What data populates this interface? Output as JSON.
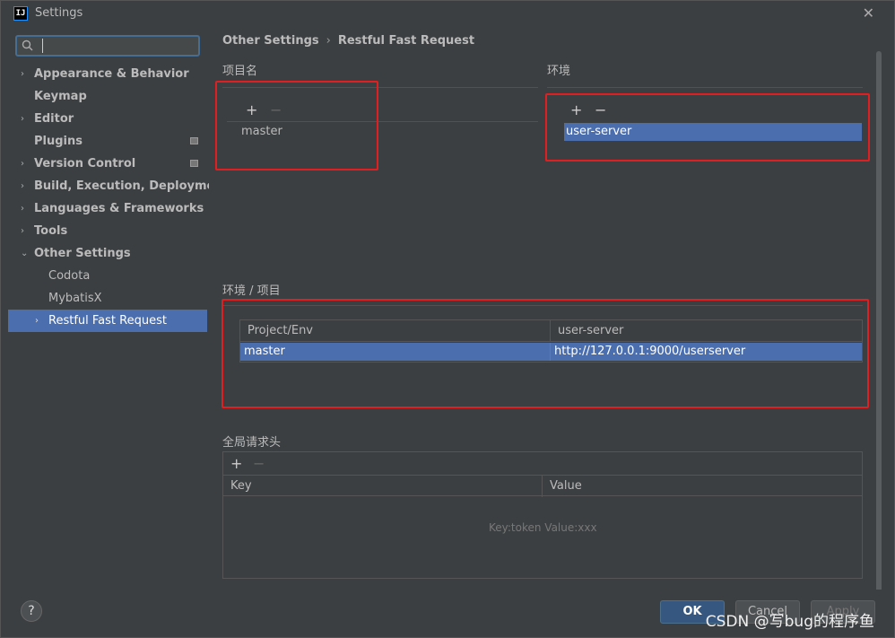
{
  "window": {
    "title": "Settings"
  },
  "search": {
    "placeholder": "",
    "value": ""
  },
  "sidebar": {
    "items": [
      {
        "label": "Appearance & Behavior",
        "arrow": "›"
      },
      {
        "label": "Keymap",
        "arrow": ""
      },
      {
        "label": "Editor",
        "arrow": "›"
      },
      {
        "label": "Plugins",
        "arrow": ""
      },
      {
        "label": "Version Control",
        "arrow": "›"
      },
      {
        "label": "Build, Execution, Deployment",
        "arrow": "›"
      },
      {
        "label": "Languages & Frameworks",
        "arrow": "›"
      },
      {
        "label": "Tools",
        "arrow": "›"
      },
      {
        "label": "Other Settings",
        "arrow": "⌄"
      },
      {
        "label": "Codota",
        "arrow": ""
      },
      {
        "label": "MybatisX",
        "arrow": ""
      },
      {
        "label": "Restful Fast Request",
        "arrow": "›"
      }
    ]
  },
  "breadcrumb": {
    "parent": "Other Settings",
    "separator": "›",
    "current": "Restful Fast Request"
  },
  "project_section": {
    "title": "项目名",
    "add": "+",
    "remove": "−",
    "items": [
      "master"
    ]
  },
  "env_section": {
    "title": "环境",
    "add": "+",
    "remove": "−",
    "items": [
      "user-server"
    ]
  },
  "mapping_section": {
    "title": "环境 / 项目",
    "headers": [
      "Project/Env",
      "user-server"
    ],
    "rows": [
      [
        "master",
        "http://127.0.0.1:9000/userserver"
      ]
    ]
  },
  "headers_section": {
    "title": "全局请求头",
    "add": "+",
    "remove": "−",
    "columns": [
      "Key",
      "Value"
    ],
    "empty_hint": "Key:token  Value:xxx"
  },
  "footer": {
    "help": "?",
    "ok": "OK",
    "cancel": "Cancel",
    "apply": "Apply",
    "watermark": "CSDN @写bug的程序鱼"
  },
  "colors": {
    "selection": "#4b6eaf",
    "highlight_box": "#e02020",
    "primary_button": "#365880"
  }
}
